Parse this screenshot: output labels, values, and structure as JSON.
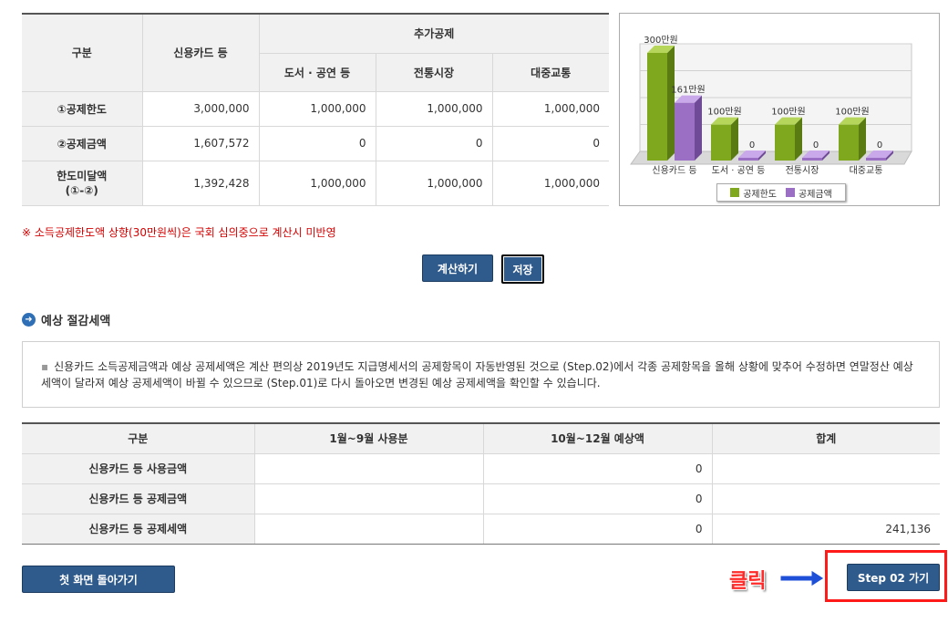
{
  "deduction_table": {
    "header": {
      "category": "구분",
      "credit_card": "신용카드 등",
      "extra": "추가공제",
      "books": "도서 · 공연 등",
      "market": "전통시장",
      "transit": "대중교통"
    },
    "rows": [
      {
        "label": "①공제한도",
        "values": [
          "3,000,000",
          "1,000,000",
          "1,000,000",
          "1,000,000"
        ]
      },
      {
        "label": "②공제금액",
        "values": [
          "1,607,572",
          "0",
          "0",
          "0"
        ]
      },
      {
        "label_line1": "한도미달액",
        "label_line2": "(①-②)",
        "values": [
          "1,392,428",
          "1,000,000",
          "1,000,000",
          "1,000,000"
        ]
      }
    ]
  },
  "chart_data": {
    "type": "bar",
    "categories": [
      "신용카드 등",
      "도서 · 공연 등",
      "전통시장",
      "대중교통"
    ],
    "series": [
      {
        "name": "공제한도",
        "values": [
          300,
          100,
          100,
          100
        ],
        "labels": [
          "300만원",
          "100만원",
          "100만원",
          "100만원"
        ],
        "color": "#7fa81f"
      },
      {
        "name": "공제금액",
        "values": [
          161,
          0,
          0,
          0
        ],
        "labels": [
          "161만원",
          "0",
          "0",
          "0"
        ],
        "color": "#9a6fc4"
      }
    ],
    "ylim": [
      0,
      300
    ],
    "grid": true,
    "legend": "bottom"
  },
  "notice": "※ 소득공제한도액 상향(30만원씩)은 국회 심의중으로 계산시 미반영",
  "buttons": {
    "calc": "계산하기",
    "save": "저장",
    "home": "첫 화면 돌아가기",
    "step": "Step 02 가기"
  },
  "section_title": "예상 절감세액",
  "info_text": "신용카드 소득공제금액과 예상 공제세액은 계산 편의상 2019년도 지급명세서의 공제항목이 자동반영된 것으로 (Step.02)에서 각종 공제항목을 올해 상황에 맞추어 수정하면 연말정산 예상세액이 달라져 예상 공제세액이 바뀔 수 있으므로 (Step.01)로 다시 돌아오면 변경된 예상 공제세액을 확인할 수 있습니다.",
  "tax_table": {
    "headers": [
      "구분",
      "1월~9월 사용분",
      "10월~12월 예상액",
      "합계"
    ],
    "rows": [
      {
        "label": "신용카드 등 사용금액",
        "values": [
          "",
          "0",
          ""
        ]
      },
      {
        "label": "신용카드 등 공제금액",
        "values": [
          "",
          "0",
          ""
        ]
      },
      {
        "label": "신용카드 등 공제세액",
        "values": [
          "",
          "0",
          "241,136"
        ]
      }
    ]
  },
  "annotation": {
    "click_label": "클릭"
  },
  "colors": {
    "button": "#2f5a8c",
    "highlight": "#ff1a1a",
    "notice": "#d40000"
  }
}
